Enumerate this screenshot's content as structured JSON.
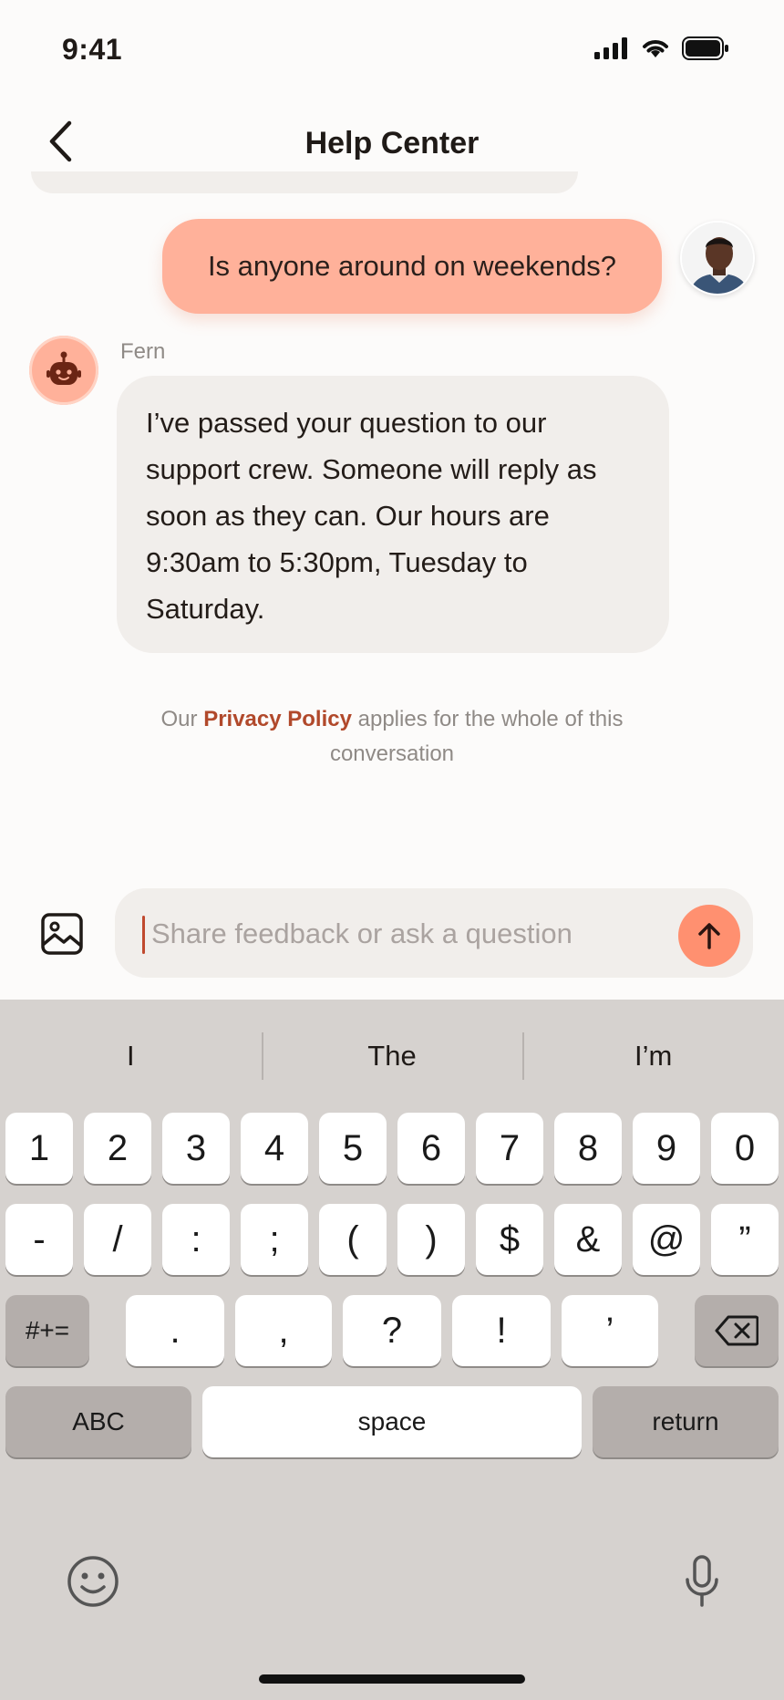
{
  "status_bar": {
    "time": "9:41"
  },
  "nav": {
    "title": "Help Center"
  },
  "messages": {
    "user_text": "Is anyone around on weekends?",
    "bot_name": "Fern",
    "bot_text": "I’ve passed your question to our support crew. Someone will reply as soon as they can. Our hours are 9:30am to 5:30pm, Tuesday to Saturday."
  },
  "privacy": {
    "prefix": "Our ",
    "link": "Privacy Policy",
    "suffix": " applies for the whole of this conversation"
  },
  "composer": {
    "placeholder": "Share feedback or ask a question"
  },
  "keyboard": {
    "suggestions": [
      "I",
      "The",
      "I’m"
    ],
    "row1": [
      "1",
      "2",
      "3",
      "4",
      "5",
      "6",
      "7",
      "8",
      "9",
      "0"
    ],
    "row2": [
      "-",
      "/",
      ":",
      ";",
      "(",
      ")",
      "$",
      "&",
      "@",
      "”"
    ],
    "row3": [
      ".",
      ",",
      "?",
      "!",
      "’"
    ],
    "symbols_key": "#+=",
    "abc_key": "ABC",
    "space_key": "space",
    "return_key": "return"
  },
  "colors": {
    "accent": "#ff9070",
    "user_bubble": "#ffb19a",
    "link": "#b1492b",
    "bot_bubble": "#f1eeeb",
    "keyboard_bg": "#d6d2cf"
  }
}
